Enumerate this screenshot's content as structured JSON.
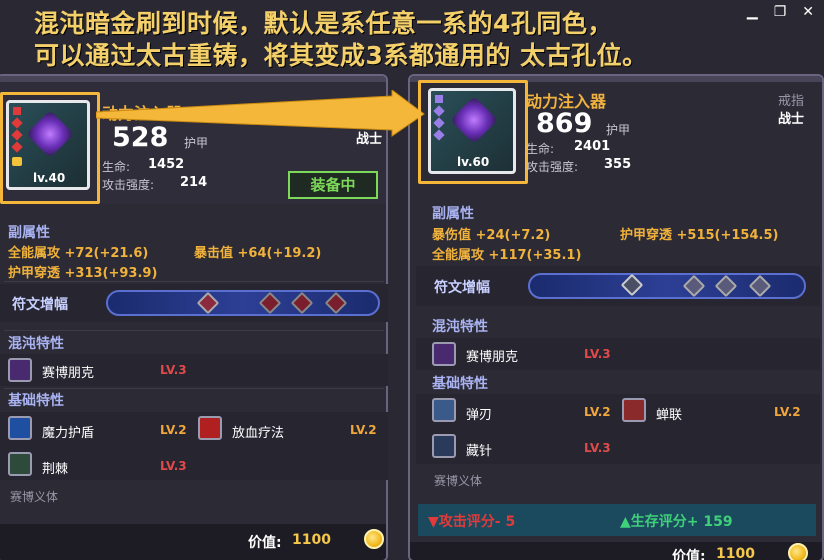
{
  "caption": {
    "line1": "混沌暗金刷到时候，默认是系任意一系的4孔同色，",
    "line2": "可以通过太古重铸，将其变成3系都通用的 太古孔位。"
  },
  "window": {
    "minimize": "▁",
    "restore": "❐",
    "close": "✕"
  },
  "left": {
    "item_name": "动力注入器",
    "level": "lv.40",
    "armor_value": "528",
    "armor_label": "护甲",
    "class": "战士",
    "hp_label": "生命:",
    "hp_value": "1452",
    "atk_label": "攻击强度:",
    "atk_value": "214",
    "equipped": "装备中",
    "sub_title": "副属性",
    "stats": [
      "全能属攻 +72(+21.6)",
      "暴击值 +64(+19.2)",
      "护甲穿透 +313(+93.9)"
    ],
    "rune_title": "符文增幅",
    "chaos_title": "混沌特性",
    "chaos_traits": [
      {
        "name": "赛博朋克",
        "lv": "LV.3"
      }
    ],
    "basic_title": "基础特性",
    "basic_traits": [
      {
        "name": "魔力护盾",
        "lv": "LV.2"
      },
      {
        "name": "放血疗法",
        "lv": "LV.2"
      },
      {
        "name": "荆棘",
        "lv": "LV.3"
      }
    ],
    "set": "赛博义体",
    "price_label": "价值:",
    "price": "1100"
  },
  "right": {
    "item_name": "动力注入器",
    "level": "lv.60",
    "armor_value": "869",
    "armor_label": "护甲",
    "slot": "戒指",
    "class": "战士",
    "hp_label": "生命:",
    "hp_value": "2401",
    "atk_label": "攻击强度:",
    "atk_value": "355",
    "sub_title": "副属性",
    "stats": [
      "暴伤值 +24(+7.2)",
      "护甲穿透 +515(+154.5)",
      "全能属攻 +117(+35.1)"
    ],
    "rune_title": "符文增幅",
    "chaos_title": "混沌特性",
    "chaos_traits": [
      {
        "name": "赛博朋克",
        "lv": "LV.3"
      }
    ],
    "basic_title": "基础特性",
    "basic_traits": [
      {
        "name": "弹刃",
        "lv": "LV.2"
      },
      {
        "name": "蝉联",
        "lv": "LV.2"
      },
      {
        "name": "藏针",
        "lv": "LV.3"
      }
    ],
    "set": "赛博义体",
    "attack_score": "▼攻击评分- 5",
    "survive_score": "▲生存评分+ 159",
    "price_label": "价值:",
    "price": "1100"
  },
  "colors": {
    "accent": "#f5b73a",
    "attack_down": "#e23a3a",
    "survive_up": "#3fd07a",
    "equipped": "#7dd95a"
  }
}
